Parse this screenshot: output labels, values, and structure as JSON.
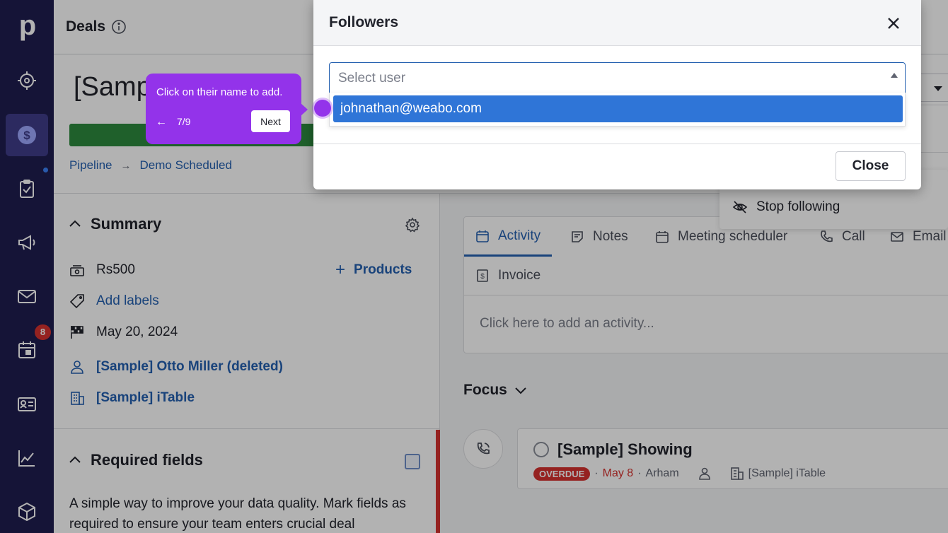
{
  "sidebar": {
    "logo": "p",
    "items": [
      {
        "icon": "target-icon"
      },
      {
        "icon": "dollar-icon",
        "active": true
      },
      {
        "icon": "clipboard-check-icon"
      },
      {
        "icon": "megaphone-icon"
      },
      {
        "icon": "mail-icon"
      },
      {
        "icon": "calendar-icon",
        "badge": "8"
      },
      {
        "icon": "contact-card-icon"
      },
      {
        "icon": "chart-line-icon"
      },
      {
        "icon": "box-icon"
      }
    ],
    "activities_badge": "8"
  },
  "header": {
    "title": "Deals"
  },
  "deal": {
    "title": "[Samp",
    "breadcrumb": {
      "pipeline": "Pipeline",
      "separator": "→",
      "stage": "Demo Scheduled"
    },
    "stage_color": "#2d8a3e"
  },
  "summary": {
    "title": "Summary",
    "value": "Rs500",
    "products_label": "Products",
    "add_labels": "Add labels",
    "close_date": "May 20, 2024",
    "person": "[Sample] Otto Miller (deleted)",
    "organization": "[Sample] iTable"
  },
  "required_fields": {
    "title": "Required fields",
    "description": "A simple way to improve your data quality. Mark fields as required to ensure your team enters crucial deal"
  },
  "tabs": [
    {
      "label": "Activity",
      "icon": "calendar-icon",
      "active": true
    },
    {
      "label": "Notes",
      "icon": "note-icon"
    },
    {
      "label": "Meeting scheduler",
      "icon": "calendar-icon"
    },
    {
      "label": "Call",
      "icon": "phone-icon"
    },
    {
      "label": "Email",
      "icon": "mail-icon"
    },
    {
      "label": "Invoice",
      "icon": "invoice-icon"
    }
  ],
  "activity_placeholder": "Click here to add an activity...",
  "focus": {
    "title": "Focus",
    "activity": {
      "title": "[Sample] Showing",
      "status": "OVERDUE",
      "date": "May 8",
      "owner": "Arham",
      "organization": "[Sample] iTable"
    }
  },
  "follow_menu": {
    "stop_following": "Stop following"
  },
  "modal": {
    "title": "Followers",
    "select_placeholder": "Select user",
    "options": [
      "johnathan@weabo.com"
    ],
    "close_label": "Close"
  },
  "tour": {
    "text": "Click on their name to add.",
    "back": "←",
    "step": "7/9",
    "next": "Next"
  },
  "colors": {
    "sidebar_bg": "#1f1d4f",
    "accent": "#2460b0",
    "tour": "#9333ea",
    "overdue": "#d6322e",
    "option_highlight": "#2f75d7"
  }
}
